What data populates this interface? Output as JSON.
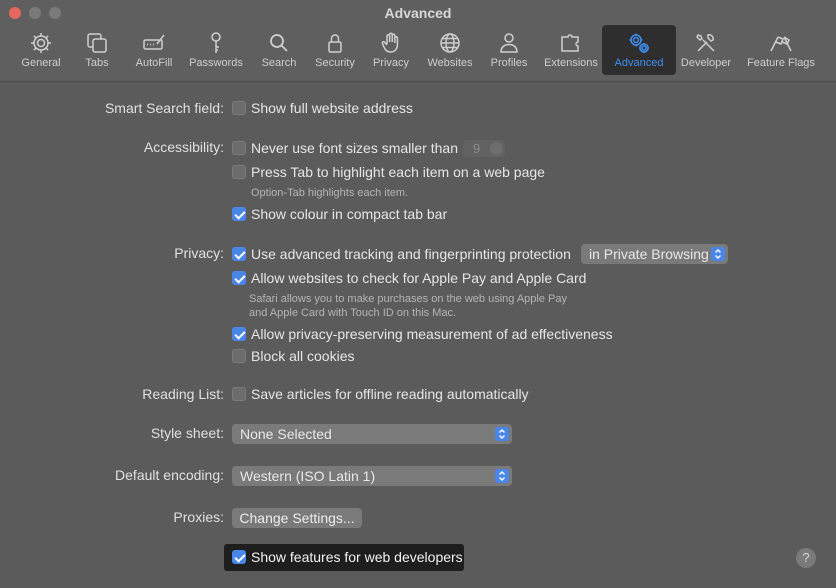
{
  "window": {
    "title": "Advanced"
  },
  "tabs": [
    {
      "label": "General",
      "icon": "gear-icon"
    },
    {
      "label": "Tabs",
      "icon": "tabs-icon"
    },
    {
      "label": "AutoFill",
      "icon": "autofill-icon"
    },
    {
      "label": "Passwords",
      "icon": "key-icon"
    },
    {
      "label": "Search",
      "icon": "search-icon"
    },
    {
      "label": "Security",
      "icon": "lock-icon"
    },
    {
      "label": "Privacy",
      "icon": "hand-icon"
    },
    {
      "label": "Websites",
      "icon": "globe-icon"
    },
    {
      "label": "Profiles",
      "icon": "person-icon"
    },
    {
      "label": "Extensions",
      "icon": "puzzle-icon"
    },
    {
      "label": "Advanced",
      "icon": "gears-icon",
      "active": true
    },
    {
      "label": "Developer",
      "icon": "tools-icon"
    },
    {
      "label": "Feature Flags",
      "icon": "flags-icon"
    }
  ],
  "smart_search": {
    "label": "Smart Search field:",
    "option": "Show full website address",
    "checked": false
  },
  "accessibility": {
    "label": "Accessibility:",
    "font_size_option": "Never use font sizes smaller than",
    "font_size_value": "9",
    "press_tab_option": "Press Tab to highlight each item on a web page",
    "press_tab_note": "Option-Tab highlights each item.",
    "colour_option": "Show colour in compact tab bar"
  },
  "privacy": {
    "label": "Privacy:",
    "tracking_option": "Use advanced tracking and fingerprinting protection",
    "tracking_popup": "in Private Browsing",
    "apple_pay_option": "Allow websites to check for Apple Pay and Apple Card",
    "apple_pay_note_1": "Safari allows you to make purchases on the web using Apple Pay",
    "apple_pay_note_2": "and Apple Card with Touch ID on this Mac.",
    "ad_option": "Allow privacy-preserving measurement of ad effectiveness",
    "cookies_option": "Block all cookies"
  },
  "reading_list": {
    "label": "Reading List:",
    "option": "Save articles for offline reading automatically"
  },
  "style_sheet": {
    "label": "Style sheet:",
    "value": "None Selected"
  },
  "encoding": {
    "label": "Default encoding:",
    "value": "Western (ISO Latin 1)"
  },
  "proxies": {
    "label": "Proxies:",
    "button": "Change Settings..."
  },
  "developer": {
    "option": "Show features for web developers",
    "checked": true
  },
  "help": {
    "label": "?"
  },
  "colors": {
    "accent": "#4a86e8",
    "active_tab": "#3d8ff2",
    "background": "#5b5b5b"
  }
}
